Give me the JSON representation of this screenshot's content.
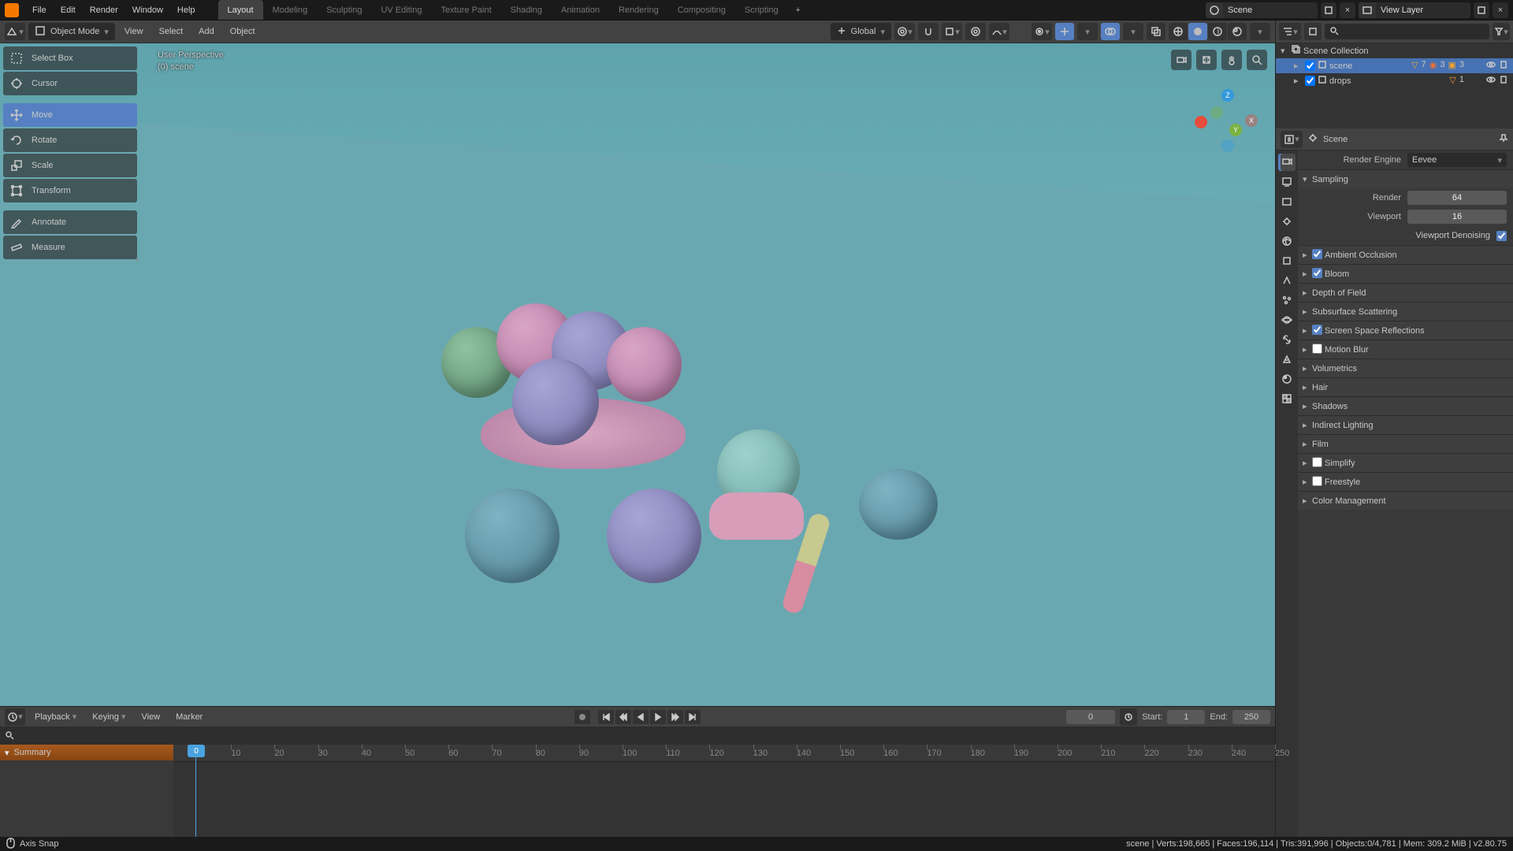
{
  "menu": {
    "file": "File",
    "edit": "Edit",
    "render": "Render",
    "window": "Window",
    "help": "Help"
  },
  "tabs": {
    "layout": "Layout",
    "modeling": "Modeling",
    "sculpting": "Sculpting",
    "uv": "UV Editing",
    "texture": "Texture Paint",
    "shading": "Shading",
    "animation": "Animation",
    "rendering": "Rendering",
    "compositing": "Compositing",
    "scripting": "Scripting"
  },
  "scene_name": "Scene",
  "viewlayer_name": "View Layer",
  "viewport": {
    "mode": "Object Mode",
    "orientation": "Global",
    "menu": {
      "view": "View",
      "select": "Select",
      "add": "Add",
      "object": "Object"
    },
    "overlay": {
      "persp": "User Perspective",
      "scene": "(0) scene"
    }
  },
  "tools": {
    "select": "Select Box",
    "cursor": "Cursor",
    "move": "Move",
    "rotate": "Rotate",
    "scale": "Scale",
    "transform": "Transform",
    "annotate": "Annotate",
    "measure": "Measure"
  },
  "outliner": {
    "root": "Scene Collection",
    "item1": "scene",
    "item1_badges": {
      "tri": "7",
      "vert": "3",
      "face": "3"
    },
    "item2": "drops",
    "item2_badges": {
      "tri": "1"
    }
  },
  "props": {
    "crumb": "Scene",
    "engine_label": "Render Engine",
    "engine_value": "Eevee",
    "sampling": {
      "title": "Sampling",
      "render_label": "Render",
      "render_value": "64",
      "viewport_label": "Viewport",
      "viewport_value": "16",
      "denoise_label": "Viewport Denoising"
    },
    "sections": {
      "ao": "Ambient Occlusion",
      "bloom": "Bloom",
      "dof": "Depth of Field",
      "sss": "Subsurface Scattering",
      "ssr": "Screen Space Reflections",
      "motion_blur": "Motion Blur",
      "volumetrics": "Volumetrics",
      "hair": "Hair",
      "shadows": "Shadows",
      "indirect": "Indirect Lighting",
      "film": "Film",
      "simplify": "Simplify",
      "freestyle": "Freestyle",
      "color_mgmt": "Color Management"
    }
  },
  "timeline": {
    "menu": {
      "playback": "Playback",
      "keying": "Keying",
      "view": "View",
      "marker": "Marker"
    },
    "current": "0",
    "start_label": "Start:",
    "start": "1",
    "end_label": "End:",
    "end": "250",
    "summary": "Summary",
    "ticks": [
      "0",
      "10",
      "20",
      "30",
      "40",
      "50",
      "60",
      "70",
      "80",
      "90",
      "100",
      "110",
      "120",
      "130",
      "140",
      "150",
      "160",
      "170",
      "180",
      "190",
      "200",
      "210",
      "220",
      "230",
      "240",
      "250"
    ]
  },
  "status": {
    "hint": "Axis Snap",
    "right": "scene | Verts:198,665 | Faces:196,114 | Tris:391,996 | Objects:0/4,781 | Mem: 309.2 MiB | v2.80.75"
  }
}
